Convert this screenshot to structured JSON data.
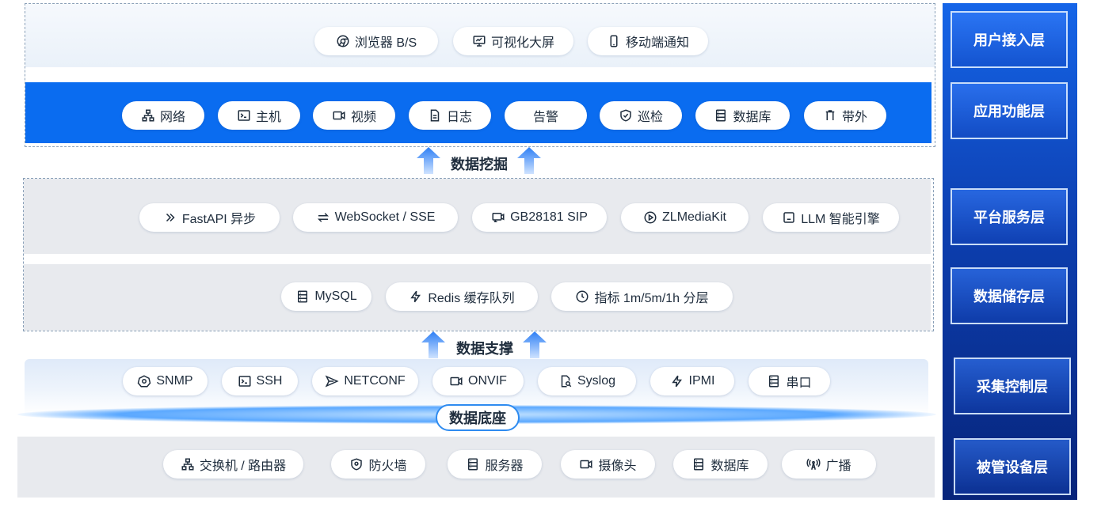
{
  "user_access": [
    "浏览器 B/S",
    "可视化大屏",
    "移动端通知"
  ],
  "app_function": [
    "网络",
    "主机",
    "视频",
    "日志",
    "告警",
    "巡检",
    "数据库",
    "带外"
  ],
  "mining_label": "数据挖掘",
  "platform_service": [
    "FastAPI 异步",
    "WebSocket / SSE",
    "GB28181 SIP",
    "ZLMediaKit",
    "LLM 智能引擎"
  ],
  "data_storage": [
    "MySQL",
    "Redis 缓存队列",
    "指标 1m/5m/1h 分层"
  ],
  "support_label": "数据支撑",
  "collect_control": [
    "SNMP",
    "SSH",
    "NETCONF",
    "ONVIF",
    "Syslog",
    "IPMI",
    "串口"
  ],
  "base_label": "数据底座",
  "managed_devices": [
    "交换机 / 路由器",
    "防火墙",
    "服务器",
    "摄像头",
    "数据库",
    "广播"
  ],
  "layers": [
    "用户接入层",
    "应用功能层",
    "平台服务层",
    "数据储存层",
    "采集控制层",
    "被管设备层"
  ],
  "colors": {
    "accent": "#0a6cf0",
    "sidebar_top": "#1565e8",
    "sidebar_bottom": "#07247a"
  }
}
